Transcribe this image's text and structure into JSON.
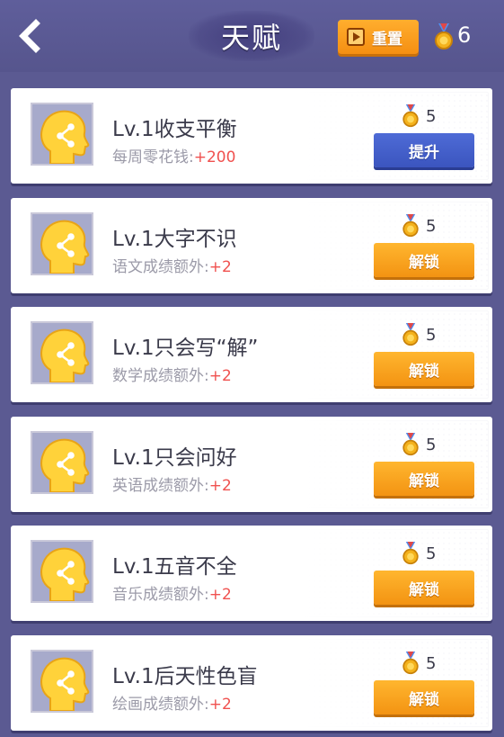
{
  "header": {
    "title": "天赋",
    "reset_label": "重置",
    "medal_count": "6"
  },
  "talents": [
    {
      "title": "Lv.1收支平衡",
      "desc_label": "每周零花钱:",
      "desc_bonus": "+200",
      "cost": "5",
      "action": "提升",
      "action_type": "upgrade"
    },
    {
      "title": "Lv.1大字不识",
      "desc_label": "语文成绩额外:",
      "desc_bonus": "+2",
      "cost": "5",
      "action": "解锁",
      "action_type": "unlock"
    },
    {
      "title": "Lv.1只会写“解”",
      "desc_label": "数学成绩额外:",
      "desc_bonus": "+2",
      "cost": "5",
      "action": "解锁",
      "action_type": "unlock"
    },
    {
      "title": "Lv.1只会问好",
      "desc_label": "英语成绩额外:",
      "desc_bonus": "+2",
      "cost": "5",
      "action": "解锁",
      "action_type": "unlock"
    },
    {
      "title": "Lv.1五音不全",
      "desc_label": "音乐成绩额外:",
      "desc_bonus": "+2",
      "cost": "5",
      "action": "解锁",
      "action_type": "unlock"
    },
    {
      "title": "Lv.1后天性色盲",
      "desc_label": "绘画成绩额外:",
      "desc_bonus": "+2",
      "cost": "5",
      "action": "解锁",
      "action_type": "unlock"
    }
  ],
  "colors": {
    "background": "#5b5a92",
    "accent_orange": "#f5a020",
    "accent_blue": "#4460cc",
    "bonus_red": "#f0514f"
  },
  "icons": {
    "back": "back-arrow-icon",
    "reset": "play-box-icon",
    "medal": "medal-icon",
    "talent": "head-network-icon"
  }
}
